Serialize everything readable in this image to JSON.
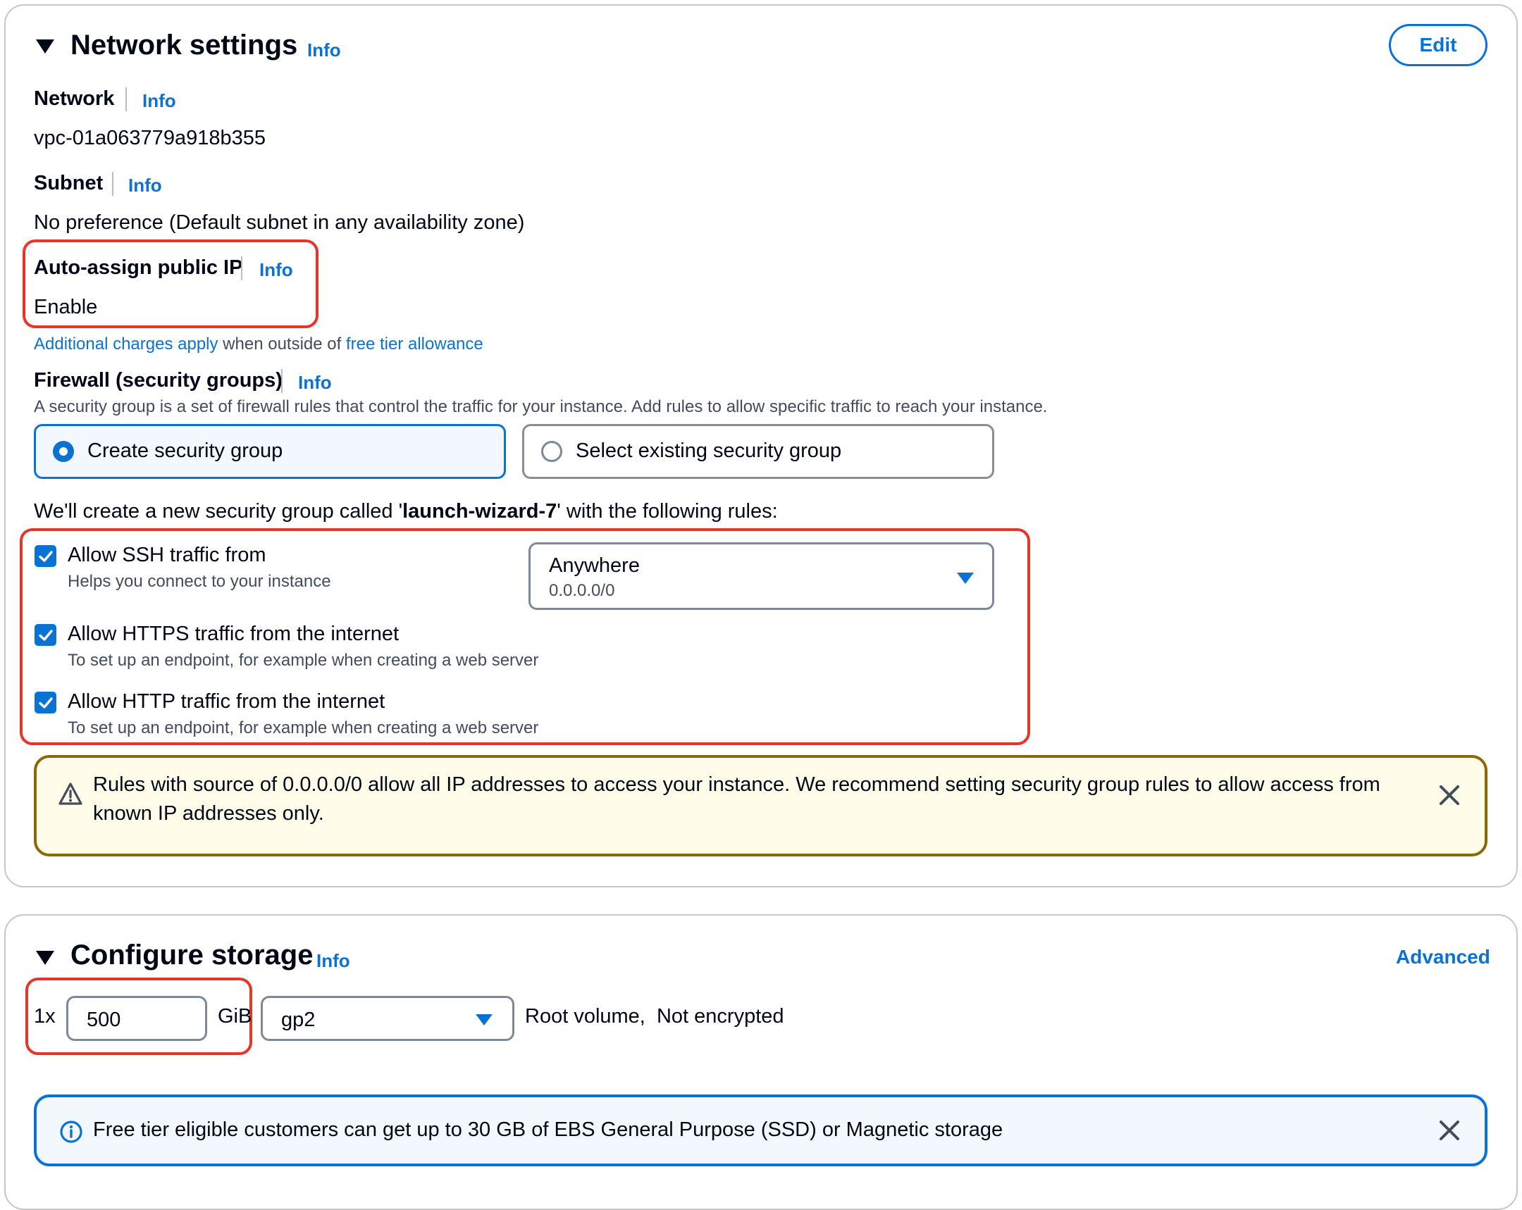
{
  "network": {
    "title": "Network settings",
    "info": "Info",
    "edit_label": "Edit",
    "network_label": "Network",
    "network_value": "vpc-01a063779a918b355",
    "subnet_label": "Subnet",
    "subnet_value": "No preference (Default subnet in any availability zone)",
    "auto_assign_label": "Auto-assign public IP",
    "auto_assign_value": "Enable",
    "charges_link": "Additional charges apply",
    "charges_mid": " when outside of ",
    "charges_link2": "free tier allowance",
    "firewall_label": "Firewall (security groups)",
    "firewall_desc": "A security group is a set of firewall rules that control the traffic for your instance. Add rules to allow specific traffic to reach your instance.",
    "sg_options": [
      {
        "label": "Create security group",
        "selected": true
      },
      {
        "label": "Select existing security group",
        "selected": false
      }
    ],
    "create_prefix": "We'll create a new security group called '",
    "create_name": "launch-wizard-7",
    "create_suffix": "' with the following rules:",
    "rules": [
      {
        "title": "Allow SSH traffic from",
        "desc": "Helps you connect to your instance",
        "checked": true
      },
      {
        "title": "Allow HTTPS traffic from the internet",
        "desc": "To set up an endpoint, for example when creating a web server",
        "checked": true
      },
      {
        "title": "Allow HTTP traffic from the internet",
        "desc": "To set up an endpoint, for example when creating a web server",
        "checked": true
      }
    ],
    "ssh_source": {
      "value": "Anywhere",
      "sub": "0.0.0.0/0"
    },
    "warning": "Rules with source of 0.0.0.0/0 allow all IP addresses to access your instance. We recommend setting security group rules to allow access from known IP addresses only."
  },
  "storage": {
    "title": "Configure storage",
    "info": "Info",
    "advanced_label": "Advanced",
    "count_label": "1x",
    "size_value": "500",
    "unit_label": "GiB",
    "volume_type": "gp2",
    "root_text": "Root volume,  Not encrypted",
    "info_alert": "Free tier eligible customers can get up to 30 GB of EBS General Purpose (SSD) or Magnetic storage"
  },
  "colors": {
    "link": "#0972d3",
    "highlight": "#e7352a",
    "warning_bg": "#fffce9",
    "warning_border": "#8d6605",
    "info_bg": "#f2f8fd"
  }
}
